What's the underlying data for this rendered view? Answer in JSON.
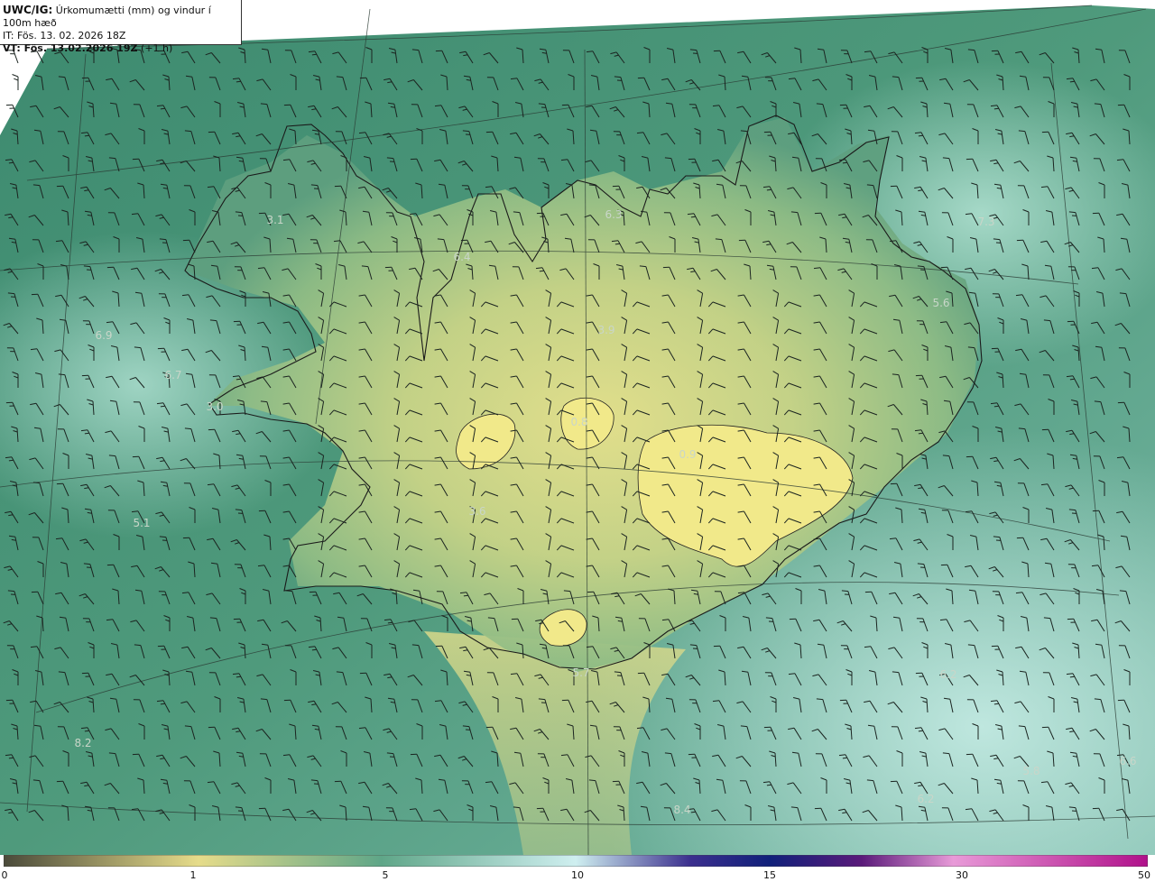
{
  "header": {
    "model": "UWC/IG:",
    "title": "Úrkomumætti (mm) og vindur í 100m hæð",
    "it_line": "IT: Fös. 13. 02. 2026 18Z",
    "vt_prefix": "VT: Fös. 13.02.2026 19Z",
    "vt_suffix": " (+1 h)"
  },
  "colorbar": {
    "ticks": [
      "0",
      "1",
      "5",
      "10",
      "15",
      "30",
      "50"
    ],
    "colors": [
      "#4a4a3a",
      "#8a7a5a",
      "#e6dc8a",
      "#5fa688",
      "#cfeff0",
      "#2b1f6e",
      "#10207a",
      "#8a1a8a",
      "#e89ad8",
      "#b0108a"
    ]
  },
  "point_values": [
    {
      "label": "3.1"
    },
    {
      "label": "6.4"
    },
    {
      "label": "6.3"
    },
    {
      "label": "7.3"
    },
    {
      "label": "6.9"
    },
    {
      "label": "6.7"
    },
    {
      "label": "3.0"
    },
    {
      "label": "5.1"
    },
    {
      "label": "3.6"
    },
    {
      "label": "5.7"
    },
    {
      "label": "6.2"
    },
    {
      "label": "8.2"
    },
    {
      "label": "5.8"
    },
    {
      "label": "6.2"
    },
    {
      "label": "8.4"
    },
    {
      "label": "0.9"
    },
    {
      "label": "0.8"
    },
    {
      "label": "3.9"
    },
    {
      "label": "5.6"
    },
    {
      "label": "6.6"
    }
  ]
}
